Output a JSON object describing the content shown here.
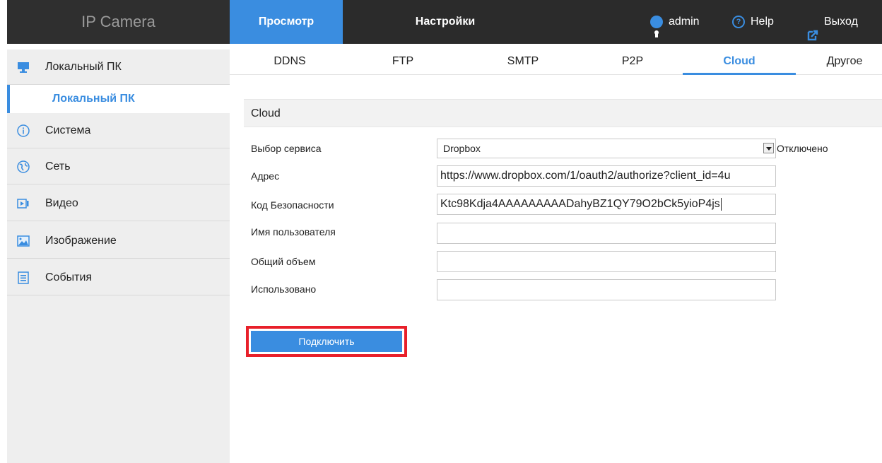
{
  "header": {
    "brand": "IP Camera",
    "tabs": [
      {
        "label": "Просмотр",
        "active": true
      },
      {
        "label": "Настройки",
        "active": false
      }
    ],
    "user": "admin",
    "help": "Help",
    "logout": "Выход",
    "accent_color": "#3a8de0"
  },
  "sidebar": {
    "items": [
      {
        "label": "Локальный ПК",
        "icon": "monitor-icon"
      },
      {
        "label": "Локальный ПК",
        "icon": null,
        "sub": true,
        "active": true
      },
      {
        "label": "Система",
        "icon": "info-icon"
      },
      {
        "label": "Сеть",
        "icon": "globe-icon"
      },
      {
        "label": "Видео",
        "icon": "video-icon"
      },
      {
        "label": "Изображение",
        "icon": "image-icon"
      },
      {
        "label": "События",
        "icon": "list-icon"
      }
    ]
  },
  "subtabs": [
    {
      "label": "DDNS",
      "active": false
    },
    {
      "label": "FTP",
      "active": false
    },
    {
      "label": "SMTP",
      "active": false
    },
    {
      "label": "P2P",
      "active": false
    },
    {
      "label": "Cloud",
      "active": true
    },
    {
      "label": "Другое",
      "active": false
    }
  ],
  "section": {
    "title": "Cloud"
  },
  "form": {
    "service_label": "Выбор сервиса",
    "service_value": "Dropbox",
    "service_status": "Отключено",
    "address_label": "Адрес",
    "address_value": "https://www.dropbox.com/1/oauth2/authorize?client_id=4u",
    "security_label": "Код Безопасности",
    "security_value": "Ktc98Kdja4AAAAAAAAADahyBZ1QY79O2bCk5yioP4js",
    "username_label": "Имя пользователя",
    "username_value": "",
    "total_label": "Общий объем",
    "total_value": "",
    "used_label": "Использовано",
    "used_value": ""
  },
  "connect_button": "Подключить",
  "highlight_color": "#e8202a"
}
